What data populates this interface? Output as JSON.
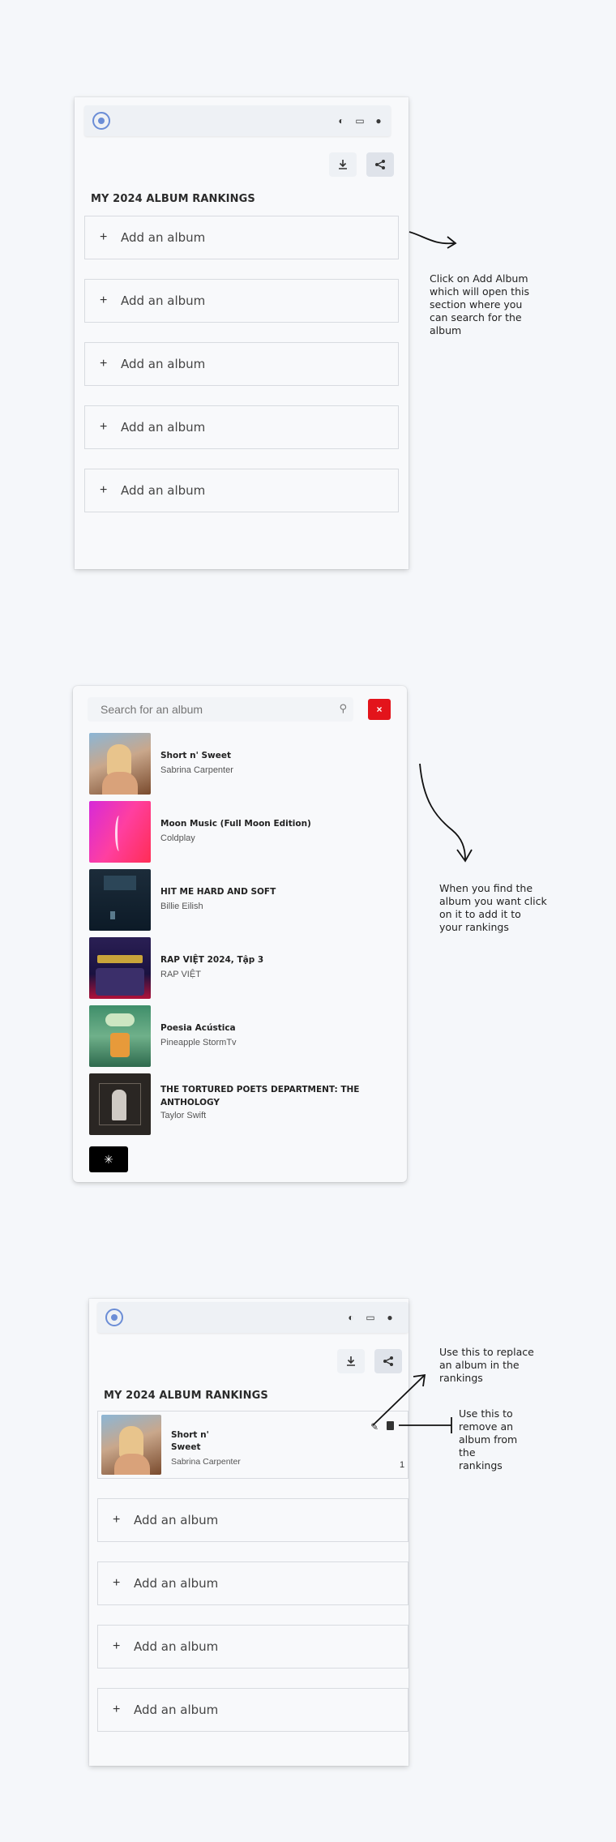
{
  "section1": {
    "heading": "MY 2024 ALBUM RANKINGS",
    "slots": [
      "Add an album",
      "Add an album",
      "Add an album",
      "Add an album",
      "Add an album"
    ],
    "annotation": [
      "Click on Add Album",
      "which will open this",
      "section where you",
      "can search for the",
      "album"
    ]
  },
  "section2": {
    "search_placeholder": "Search for an album",
    "results": [
      {
        "title": "Short n' Sweet",
        "artist": "Sabrina Carpenter"
      },
      {
        "title": "Moon Music (Full Moon Edition)",
        "artist": "Coldplay"
      },
      {
        "title": "HIT ME HARD AND SOFT",
        "artist": "Billie Eilish"
      },
      {
        "title": "RAP VIỆT 2024, Tập 3",
        "artist": "RAP VIỆT"
      },
      {
        "title": "Poesia Acústica",
        "artist": "Pineapple StormTv"
      },
      {
        "title": "THE TORTURED POETS DEPARTMENT: THE ANTHOLOGY",
        "artist": "Taylor Swift"
      }
    ],
    "annotation": [
      "When you find the",
      "album you want click",
      "on it to add it to",
      "your rankings"
    ]
  },
  "section3": {
    "heading": "MY 2024 ALBUM RANKINGS",
    "ranked": {
      "title_line1": "Short n'",
      "title_line2": "Sweet",
      "artist": "Sabrina Carpenter",
      "rank": "1"
    },
    "slots": [
      "Add an album",
      "Add an album",
      "Add an album",
      "Add an album"
    ],
    "annotation_replace": [
      "Use this to replace",
      "an album in the",
      "rankings"
    ],
    "annotation_remove": [
      "Use this to",
      "remove an",
      "album from",
      "the",
      "rankings"
    ]
  },
  "icons": {
    "close": "×",
    "plus": "+",
    "download": "download-icon",
    "share": "share-icon"
  },
  "colors": {
    "accent_red": "#e3141b",
    "logo_blue": "#6b8dd6"
  }
}
